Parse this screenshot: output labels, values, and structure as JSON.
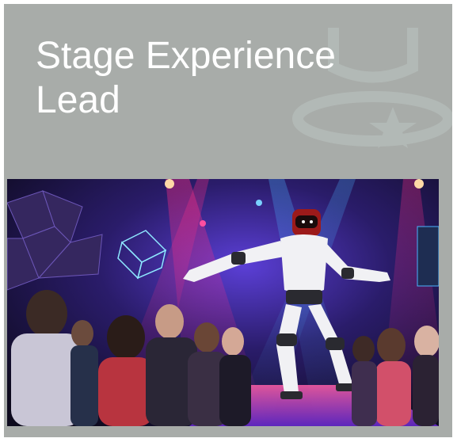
{
  "card": {
    "title": "Stage Experience Lead",
    "background_color": "#a8aca9",
    "title_color": "#ffffff"
  },
  "hero_image": {
    "description_icon": "robot-dancing-stage-photo"
  },
  "watermark": {
    "icon": "stage-spotlight-star-icon"
  }
}
